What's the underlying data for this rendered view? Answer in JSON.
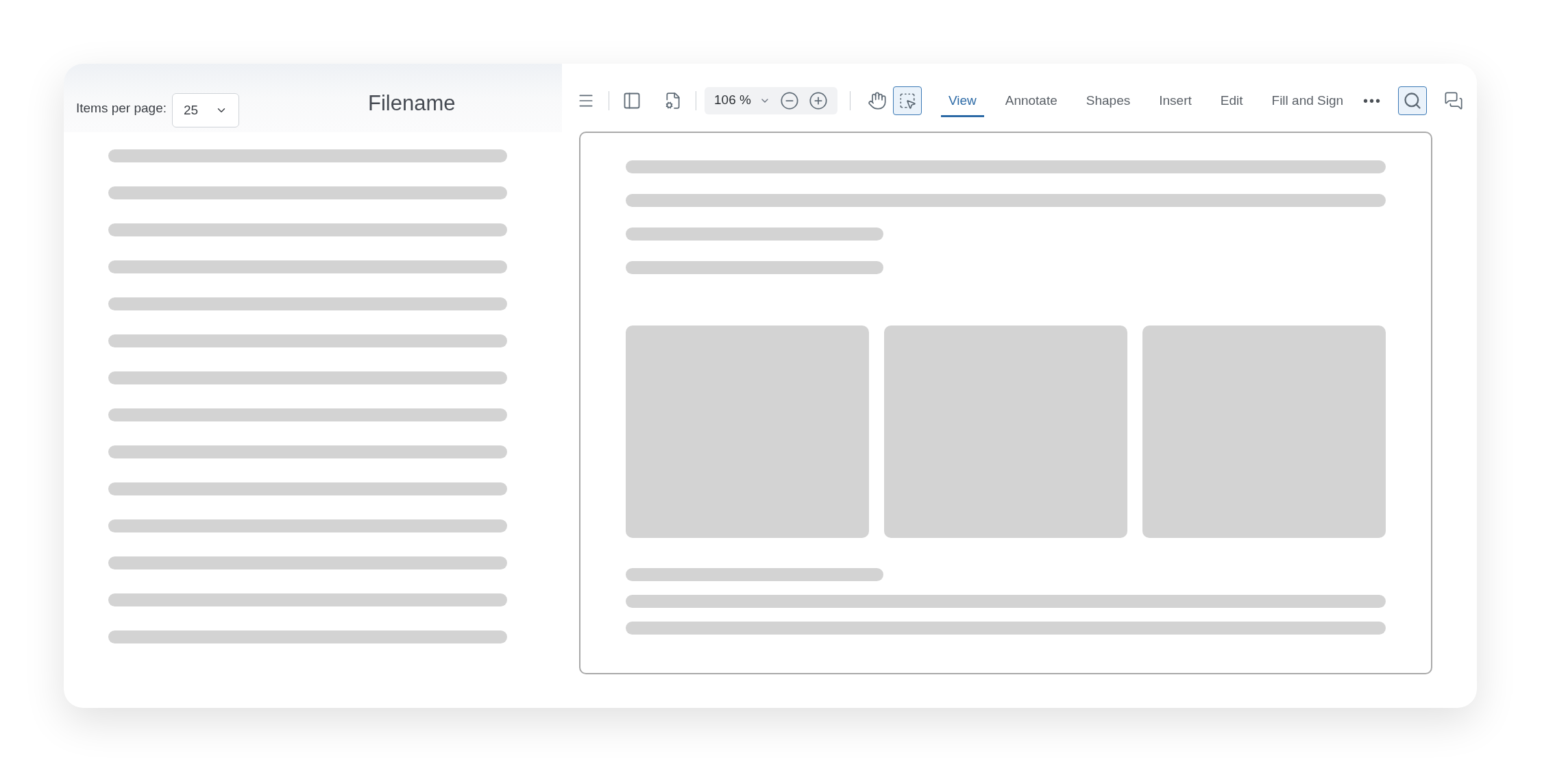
{
  "list_header": {
    "items_per_page_label": "Items per page:",
    "items_per_page_value": "25",
    "title": "Filename"
  },
  "toolbar": {
    "zoom": "106 %",
    "select_tool_selected": true,
    "search_selected": true,
    "tabs": [
      {
        "label": "View",
        "selected": true
      },
      {
        "label": "Annotate",
        "selected": false
      },
      {
        "label": "Shapes",
        "selected": false
      },
      {
        "label": "Insert",
        "selected": false
      },
      {
        "label": "Edit",
        "selected": false
      },
      {
        "label": "Fill and Sign",
        "selected": false
      }
    ],
    "more": "•••"
  }
}
